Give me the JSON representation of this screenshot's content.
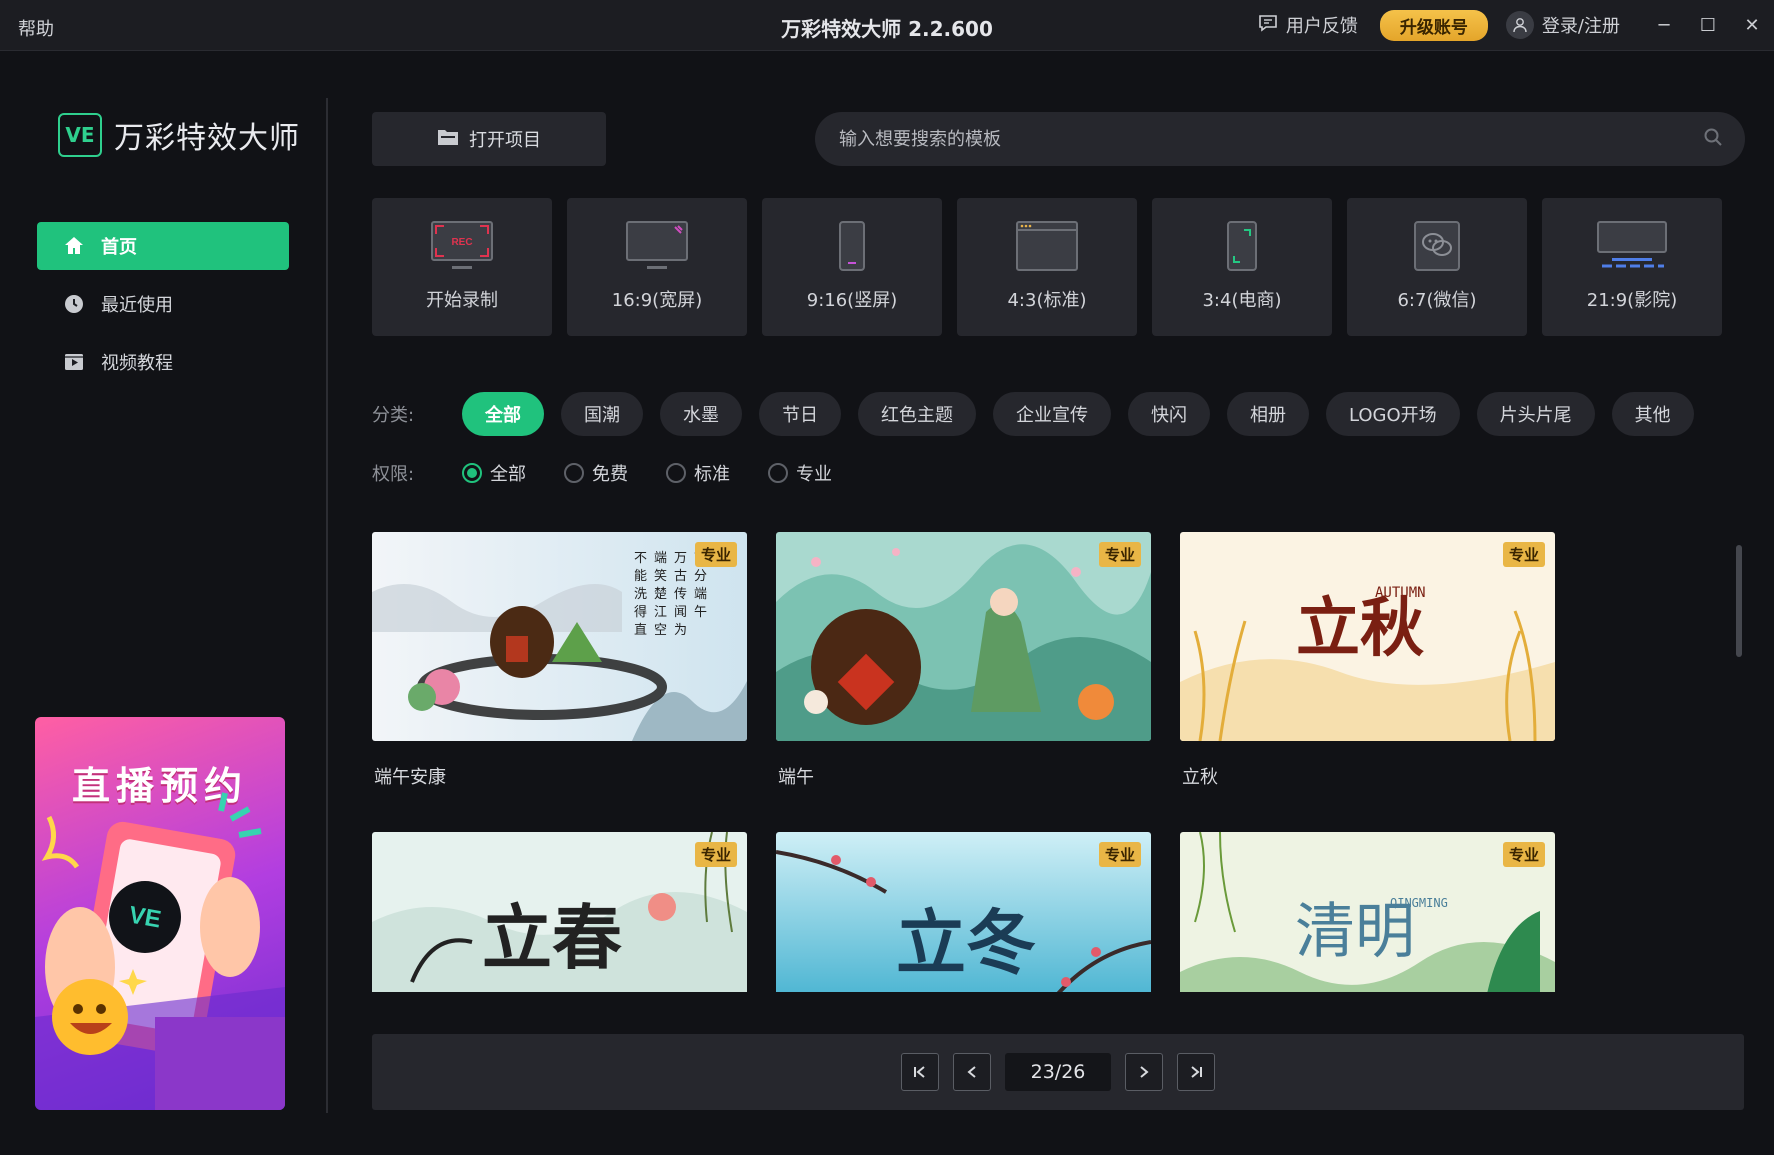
{
  "titlebar": {
    "help": "帮助",
    "title": "万彩特效大师 2.2.600",
    "feedback": "用户反馈",
    "upgrade": "升级账号",
    "login": "登录/注册"
  },
  "brand": {
    "logo_mark": "VE",
    "name": "万彩特效大师",
    "accent": "#20c27d"
  },
  "sidebar": {
    "items": [
      {
        "label": "首页",
        "icon": "home-icon",
        "active": true
      },
      {
        "label": "最近使用",
        "icon": "clock-icon",
        "active": false
      },
      {
        "label": "视频教程",
        "icon": "video-icon",
        "active": false
      }
    ],
    "promo": {
      "title": "直播预约",
      "mark": "VE"
    }
  },
  "toolbar": {
    "open_project": "打开项目",
    "search_placeholder": "输入想要搜索的模板"
  },
  "ratios": [
    {
      "label": "开始录制",
      "icon": "record-icon",
      "rec_text": "REC"
    },
    {
      "label": "16:9(宽屏)",
      "icon": "widescreen-icon"
    },
    {
      "label": "9:16(竖屏)",
      "icon": "portrait-icon"
    },
    {
      "label": "4:3(标准)",
      "icon": "standard-icon"
    },
    {
      "label": "3:4(电商)",
      "icon": "ecommerce-icon"
    },
    {
      "label": "6:7(微信)",
      "icon": "wechat-icon"
    },
    {
      "label": "21:9(影院)",
      "icon": "cinema-icon"
    }
  ],
  "filters": {
    "category_label": "分类:",
    "categories": [
      "全部",
      "国潮",
      "水墨",
      "节日",
      "红色主题",
      "企业宣传",
      "快闪",
      "相册",
      "LOGO开场",
      "片头片尾",
      "其他"
    ],
    "active_category": "全部",
    "permission_label": "权限:",
    "permissions": [
      "全部",
      "免费",
      "标准",
      "专业"
    ],
    "active_permission": "全部"
  },
  "templates": [
    {
      "title": "端午安康",
      "badge": "专业",
      "theme": "duanwu-ink"
    },
    {
      "title": "端午",
      "badge": "专业",
      "theme": "duanwu-green"
    },
    {
      "title": "立秋",
      "badge": "专业",
      "theme": "liqiu",
      "art_text": "立秋",
      "art_sub": "AUTUMN"
    },
    {
      "title": "",
      "badge": "专业",
      "theme": "lichun",
      "art_text": "立春"
    },
    {
      "title": "",
      "badge": "专业",
      "theme": "lidong",
      "art_text": "立冬"
    },
    {
      "title": "",
      "badge": "专业",
      "theme": "qingming",
      "art_text": "清明",
      "art_sub": "QINGMING"
    }
  ],
  "pagination": {
    "current": 23,
    "total": 26,
    "display": "23/26"
  }
}
